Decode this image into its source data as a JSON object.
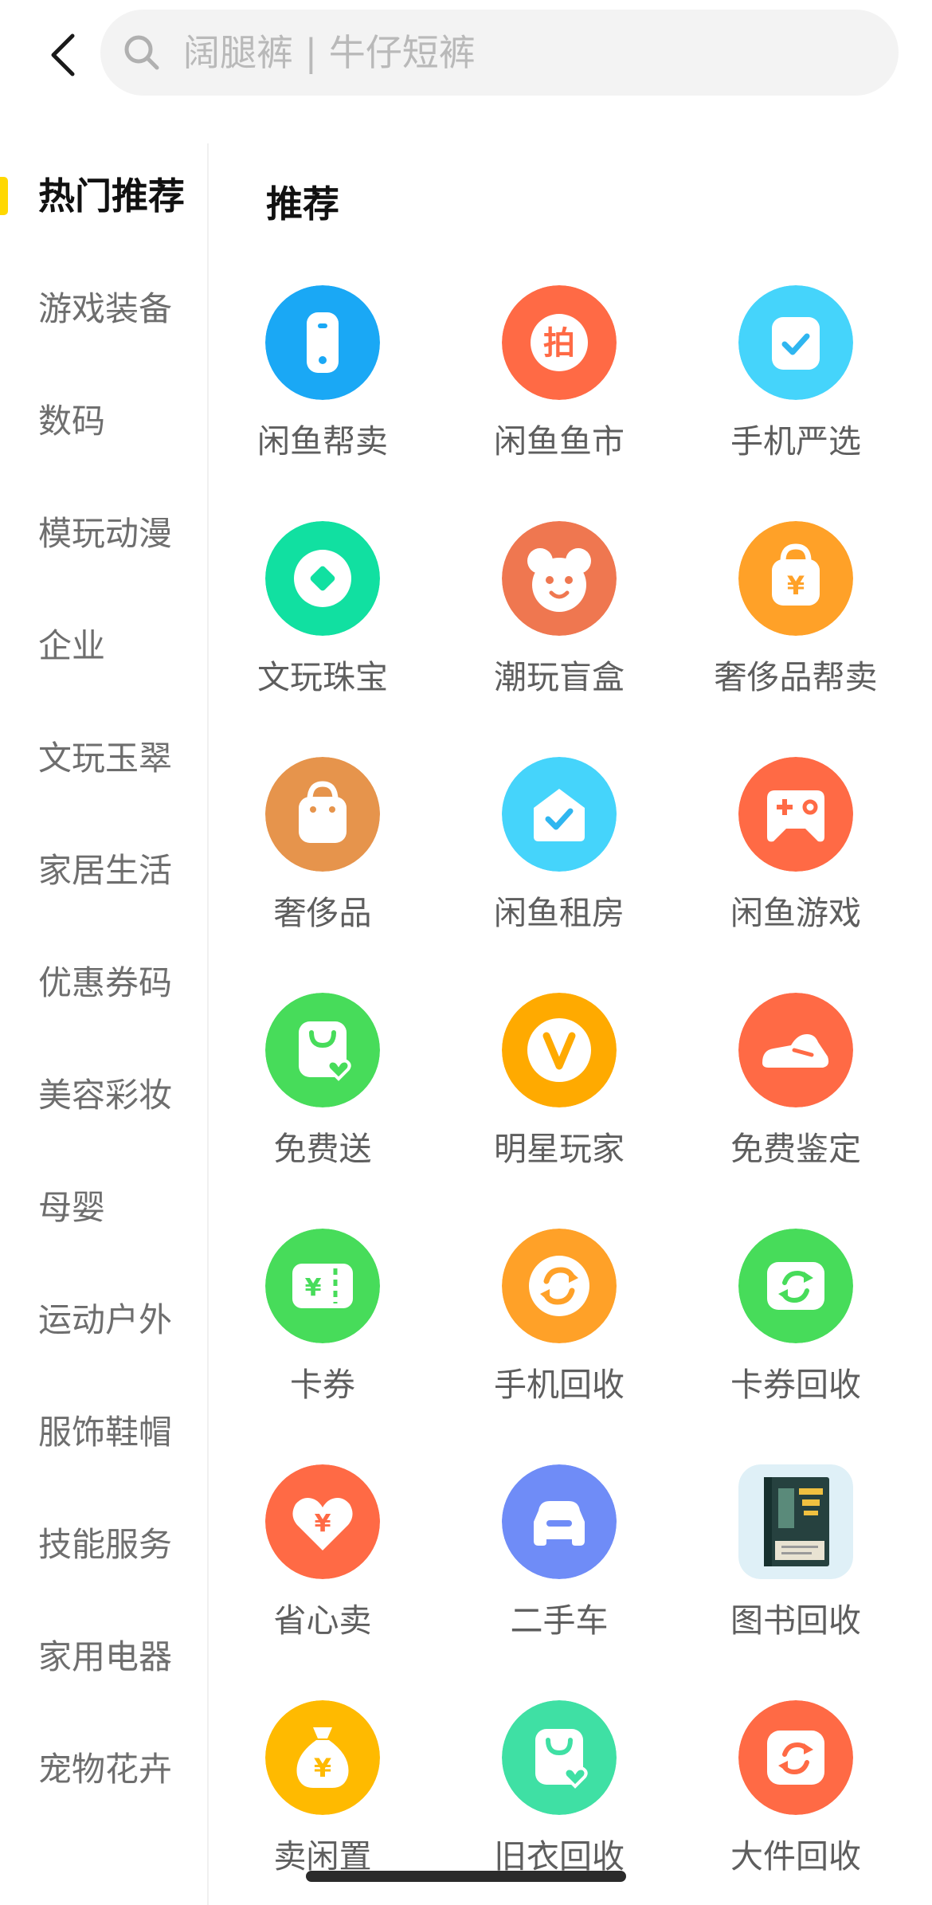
{
  "search": {
    "placeholder": "阔腿裤 | 牛仔短裤"
  },
  "sidebar": {
    "items": [
      {
        "label": "热门推荐",
        "active": true
      },
      {
        "label": "游戏装备"
      },
      {
        "label": "数码"
      },
      {
        "label": "模玩动漫"
      },
      {
        "label": "企业"
      },
      {
        "label": "文玩玉翠"
      },
      {
        "label": "家居生活"
      },
      {
        "label": "优惠券码"
      },
      {
        "label": "美容彩妆"
      },
      {
        "label": "母婴"
      },
      {
        "label": "运动户外"
      },
      {
        "label": "服饰鞋帽"
      },
      {
        "label": "技能服务"
      },
      {
        "label": "家用电器"
      },
      {
        "label": "宠物花卉"
      }
    ]
  },
  "main": {
    "section_title": "推荐",
    "items": [
      {
        "label": "闲鱼帮卖",
        "icon": "phone-icon",
        "color": "#1aa8f5"
      },
      {
        "label": "闲鱼鱼市",
        "icon": "auction-icon",
        "color": "#ff6a45"
      },
      {
        "label": "手机严选",
        "icon": "check-card-icon",
        "color": "#45d4fb"
      },
      {
        "label": "文玩珠宝",
        "icon": "gem-icon",
        "color": "#11e0a1"
      },
      {
        "label": "潮玩盲盒",
        "icon": "bear-icon",
        "color": "#ef7750"
      },
      {
        "label": "奢侈品帮卖",
        "icon": "yen-bag-icon",
        "color": "#ffa128"
      },
      {
        "label": "奢侈品",
        "icon": "bag-icon",
        "color": "#e6944c"
      },
      {
        "label": "闲鱼租房",
        "icon": "house-icon",
        "color": "#45d4fb"
      },
      {
        "label": "闲鱼游戏",
        "icon": "gamepad-icon",
        "color": "#ff6a45"
      },
      {
        "label": "免费送",
        "icon": "gift-bag-icon",
        "color": "#47dc5a"
      },
      {
        "label": "明星玩家",
        "icon": "v-badge-icon",
        "color": "#ffaa00"
      },
      {
        "label": "免费鉴定",
        "icon": "sneaker-icon",
        "color": "#ff6a45"
      },
      {
        "label": "卡券",
        "icon": "ticket-icon",
        "color": "#47dc5a"
      },
      {
        "label": "手机回收",
        "icon": "recycle-icon",
        "color": "#ffa128"
      },
      {
        "label": "卡券回收",
        "icon": "recycle-card-icon",
        "color": "#47dc5a"
      },
      {
        "label": "省心卖",
        "icon": "heart-yen-icon",
        "color": "#ff6a45"
      },
      {
        "label": "二手车",
        "icon": "car-icon",
        "color": "#6f8cf7"
      },
      {
        "label": "图书回收",
        "icon": "book-cover-icon",
        "color": "#dff0f7"
      },
      {
        "label": "卖闲置",
        "icon": "money-bag-icon",
        "color": "#ffba00"
      },
      {
        "label": "旧衣回收",
        "icon": "clothes-bag-icon",
        "color": "#3fe0a4"
      },
      {
        "label": "大件回收",
        "icon": "big-recycle-icon",
        "color": "#ff6a45"
      }
    ]
  }
}
